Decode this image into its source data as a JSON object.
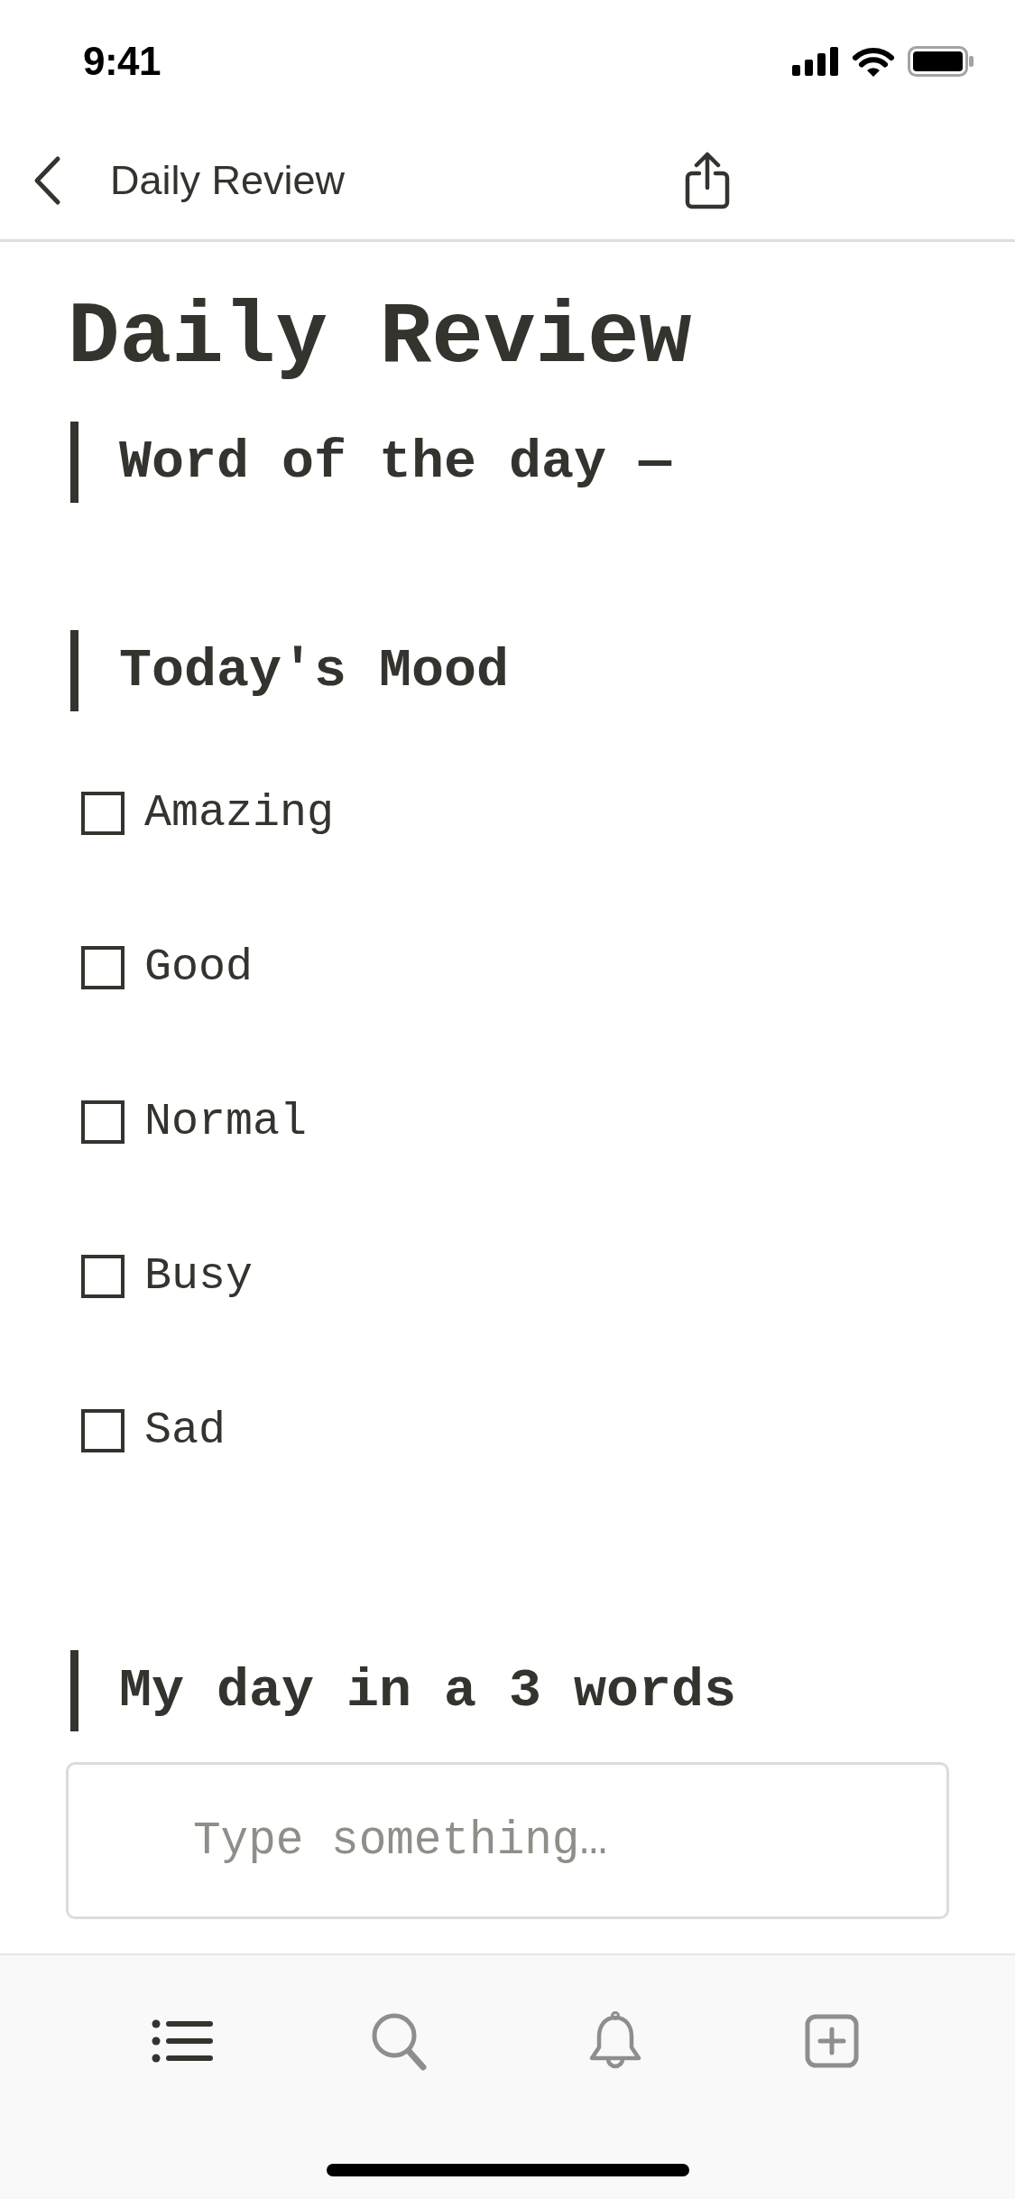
{
  "status_bar": {
    "time": "9:41"
  },
  "nav_bar": {
    "title": "Daily Review"
  },
  "page": {
    "title": "Daily Review",
    "blocks": [
      {
        "kind": "heading",
        "text": "Word of the day —"
      },
      {
        "kind": "heading",
        "text": "Today's Mood"
      },
      {
        "kind": "checkbox",
        "label": "Amazing",
        "checked": false
      },
      {
        "kind": "checkbox",
        "label": "Good",
        "checked": false
      },
      {
        "kind": "checkbox",
        "label": "Normal",
        "checked": false
      },
      {
        "kind": "checkbox",
        "label": "Busy",
        "checked": false
      },
      {
        "kind": "checkbox",
        "label": "Sad",
        "checked": false
      },
      {
        "kind": "heading",
        "text": "My day in a 3 words"
      },
      {
        "kind": "text_input",
        "placeholder": "Type something…"
      }
    ]
  },
  "tab_bar": {
    "tabs": [
      {
        "selected": true
      },
      {
        "selected": false
      },
      {
        "selected": false
      },
      {
        "selected": false
      }
    ]
  }
}
